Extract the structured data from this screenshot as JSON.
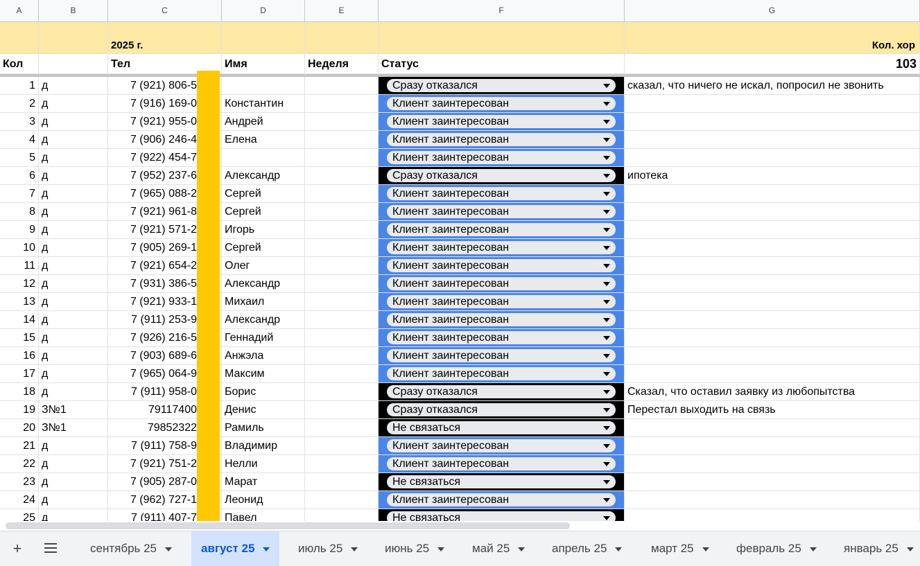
{
  "columns": [
    "A",
    "B",
    "C",
    "D",
    "E",
    "F",
    "G"
  ],
  "header_row1": {
    "year": "2025 г.",
    "kol_hor": "Кол. хор"
  },
  "header_row2": {
    "kol": "Кол",
    "tel": "Тел",
    "name": "Имя",
    "week": "Неделя",
    "status": "Статус",
    "count": "103"
  },
  "status_colors": {
    "Сразу отказался": "#000000",
    "Не связаться": "#000000",
    "Клиент заинтересован": "#4a86e8"
  },
  "rows": [
    {
      "n": "1",
      "b": "д",
      "tel": "7 (921) 806-5",
      "name": "",
      "status": "Сразу отказался",
      "note": "сказал, что ничего не искал, попросил не звонить"
    },
    {
      "n": "2",
      "b": "д",
      "tel": "7 (916) 169-0",
      "name": "Константин",
      "status": "Клиент заинтересован",
      "note": ""
    },
    {
      "n": "3",
      "b": "д",
      "tel": "7 (921) 955-0",
      "name": "Андрей",
      "status": "Клиент заинтересован",
      "note": ""
    },
    {
      "n": "4",
      "b": "д",
      "tel": "7 (906) 246-4",
      "name": "Елена",
      "status": "Клиент заинтересован",
      "note": ""
    },
    {
      "n": "5",
      "b": "д",
      "tel": "7 (922) 454-7",
      "name": "",
      "status": "Клиент заинтересован",
      "note": ""
    },
    {
      "n": "6",
      "b": "д",
      "tel": "7 (952) 237-6",
      "name": "Александр",
      "status": "Сразу отказался",
      "note": "ипотека"
    },
    {
      "n": "7",
      "b": "д",
      "tel": "7 (965) 088-2",
      "name": "Сергей",
      "status": "Клиент заинтересован",
      "note": ""
    },
    {
      "n": "8",
      "b": "д",
      "tel": "7 (921) 961-8",
      "name": "Сергей",
      "status": "Клиент заинтересован",
      "note": ""
    },
    {
      "n": "9",
      "b": "д",
      "tel": "7 (921) 571-2",
      "name": "Игорь",
      "status": "Клиент заинтересован",
      "note": ""
    },
    {
      "n": "10",
      "b": "д",
      "tel": "7 (905) 269-1",
      "name": "Сергей",
      "status": "Клиент заинтересован",
      "note": ""
    },
    {
      "n": "11",
      "b": "д",
      "tel": "7 (921) 654-2",
      "name": "Олег",
      "status": "Клиент заинтересован",
      "note": ""
    },
    {
      "n": "12",
      "b": "д",
      "tel": "7 (931) 386-5",
      "name": "Александр",
      "status": "Клиент заинтересован",
      "note": ""
    },
    {
      "n": "13",
      "b": "д",
      "tel": "7 (921) 933-1",
      "name": "Михаил",
      "status": "Клиент заинтересован",
      "note": ""
    },
    {
      "n": "14",
      "b": "д",
      "tel": "7 (911) 253-9",
      "name": "Александр",
      "status": "Клиент заинтересован",
      "note": ""
    },
    {
      "n": "15",
      "b": "д",
      "tel": "7 (926) 216-5",
      "name": "Геннадий",
      "status": "Клиент заинтересован",
      "note": ""
    },
    {
      "n": "16",
      "b": "д",
      "tel": "7 (903) 689-6",
      "name": "Анжэла",
      "status": "Клиент заинтересован",
      "note": ""
    },
    {
      "n": "17",
      "b": "д",
      "tel": "7 (965) 064-9",
      "name": "Максим",
      "status": "Клиент заинтересован",
      "note": ""
    },
    {
      "n": "18",
      "b": "д",
      "tel": "7 (911) 958-0",
      "name": "Борис",
      "status": "Сразу отказался",
      "note": "Сказал, что оставил заявку из любопытства"
    },
    {
      "n": "19",
      "b": "З№1",
      "tel": "79117400",
      "name": "Денис",
      "status": "Сразу отказался",
      "note": "Перестал выходить на связь"
    },
    {
      "n": "20",
      "b": "З№1",
      "tel": "79852322",
      "name": "Рамиль",
      "status": "Не связаться",
      "note": ""
    },
    {
      "n": "21",
      "b": "д",
      "tel": "7 (911) 758-9",
      "name": "Владимир",
      "status": "Клиент заинтересован",
      "note": ""
    },
    {
      "n": "22",
      "b": "д",
      "tel": "7 (921) 751-2",
      "name": "Нелли",
      "status": "Клиент заинтересован",
      "note": ""
    },
    {
      "n": "23",
      "b": "д",
      "tel": "7 (905) 287-0",
      "name": "Марат",
      "status": "Не связаться",
      "note": ""
    },
    {
      "n": "24",
      "b": "д",
      "tel": "7 (962) 727-1",
      "name": "Леонид",
      "status": "Клиент заинтересован",
      "note": ""
    },
    {
      "n": "25",
      "b": "д",
      "tel": "7 (911) 407-7",
      "name": "Павел",
      "status": "Не связаться",
      "note": ""
    }
  ],
  "tabs": [
    {
      "label": "сентябрь 25",
      "active": false
    },
    {
      "label": "август 25",
      "active": true
    },
    {
      "label": "июль 25",
      "active": false
    },
    {
      "label": "июнь 25",
      "active": false
    },
    {
      "label": "май 25",
      "active": false
    },
    {
      "label": "апрель 25",
      "active": false
    },
    {
      "label": "март 25",
      "active": false
    },
    {
      "label": "февраль 25",
      "active": false
    },
    {
      "label": "январь 25",
      "active": false
    }
  ],
  "toolbar": {
    "add_icon": "plus-icon",
    "sheets_icon": "menu-icon",
    "add_label": "+"
  }
}
